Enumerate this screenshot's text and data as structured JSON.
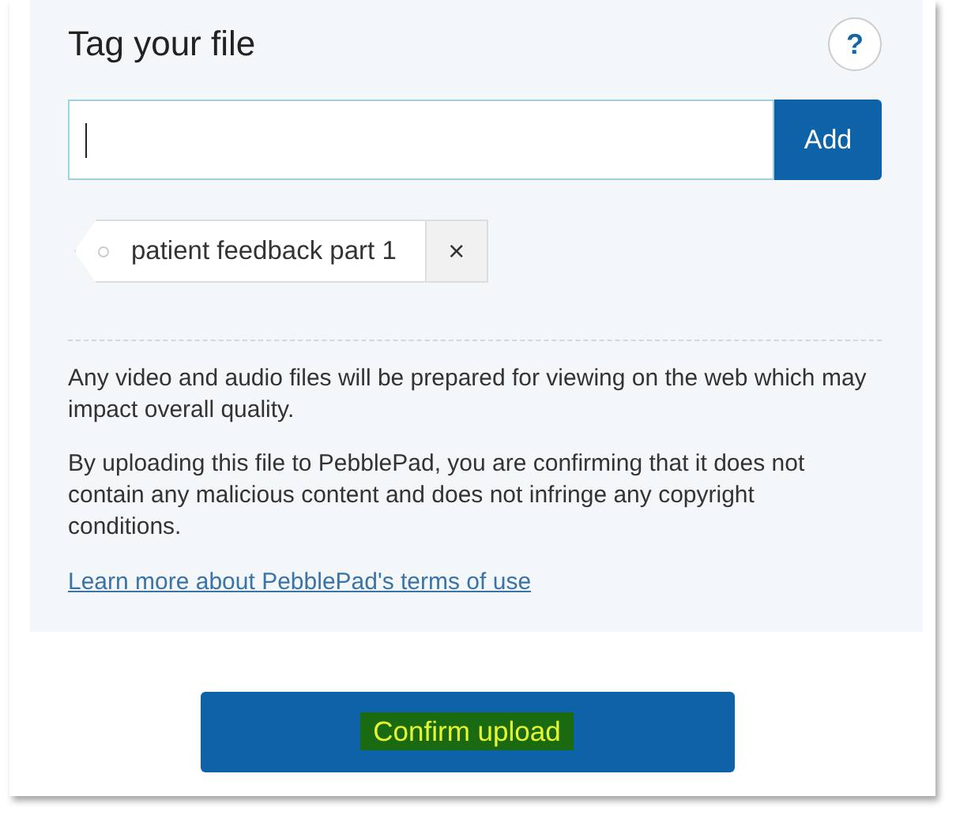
{
  "section": {
    "title": "Tag your file",
    "help_button": "?"
  },
  "tag_input": {
    "focused": true,
    "button": "Add"
  },
  "tags": [
    {
      "label": "patient feedback part 1",
      "remove": "×"
    }
  ],
  "notes": [
    "Any video and audio files will be prepared for viewing on the web which may impact overall quality.",
    "By uploading this file to PebblePad, you are confirming that it does not contain any malicious content and does not infringe any copyright conditions."
  ],
  "terms_link": "Learn more about PebblePad's terms of use",
  "confirm_button": {
    "label": "Confirm upload",
    "highlighted": true
  }
}
